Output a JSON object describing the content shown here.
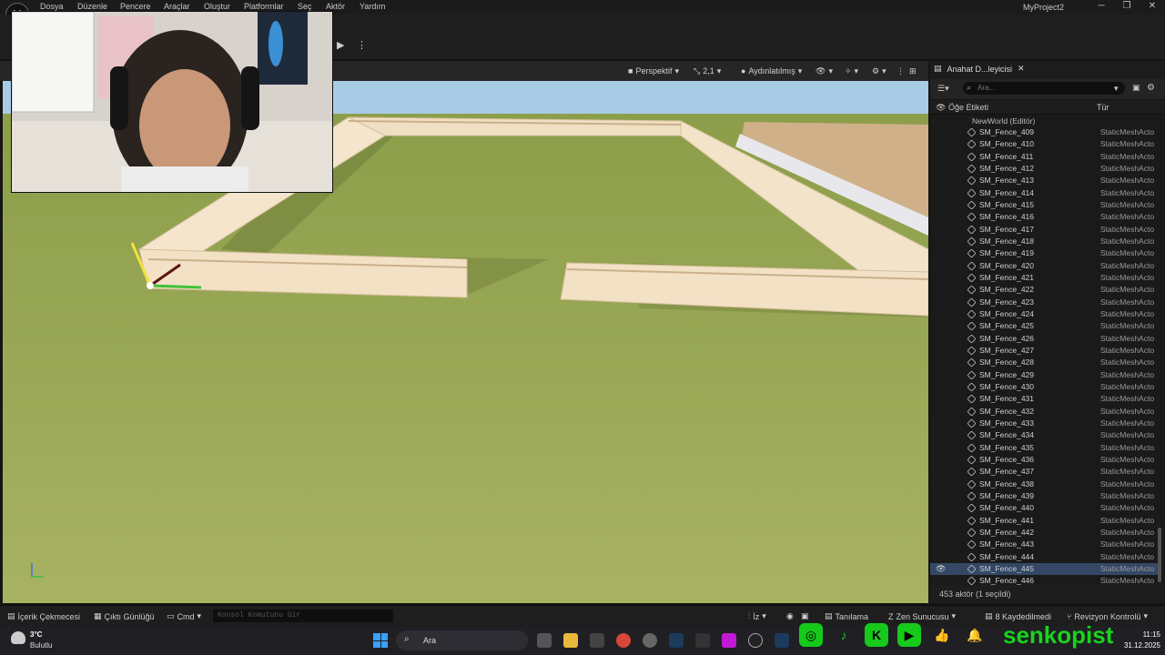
{
  "menu": [
    "Dosya",
    "Düzenle",
    "Pencere",
    "Araçlar",
    "Oluştur",
    "Platformlar",
    "Seç",
    "Aktör",
    "Yardım"
  ],
  "project_title": "MyProject2",
  "viewport": {
    "perspective": "Perspektif",
    "scale": "2,1",
    "lighting": "Aydınlatılmış"
  },
  "outliner": {
    "tab_title": "Anahat D...leyicisi",
    "search_placeholder": "Ara...",
    "col_label": "Öğe Etiketi",
    "col_type": "Tür",
    "world": "NewWorld (Editör)",
    "rows": [
      {
        "name": "SM_Fence_409",
        "type": "StaticMeshActo"
      },
      {
        "name": "SM_Fence_410",
        "type": "StaticMeshActo"
      },
      {
        "name": "SM_Fence_411",
        "type": "StaticMeshActo"
      },
      {
        "name": "SM_Fence_412",
        "type": "StaticMeshActo"
      },
      {
        "name": "SM_Fence_413",
        "type": "StaticMeshActo"
      },
      {
        "name": "SM_Fence_414",
        "type": "StaticMeshActo"
      },
      {
        "name": "SM_Fence_415",
        "type": "StaticMeshActo"
      },
      {
        "name": "SM_Fence_416",
        "type": "StaticMeshActo"
      },
      {
        "name": "SM_Fence_417",
        "type": "StaticMeshActo"
      },
      {
        "name": "SM_Fence_418",
        "type": "StaticMeshActo"
      },
      {
        "name": "SM_Fence_419",
        "type": "StaticMeshActo"
      },
      {
        "name": "SM_Fence_420",
        "type": "StaticMeshActo"
      },
      {
        "name": "SM_Fence_421",
        "type": "StaticMeshActo"
      },
      {
        "name": "SM_Fence_422",
        "type": "StaticMeshActo"
      },
      {
        "name": "SM_Fence_423",
        "type": "StaticMeshActo"
      },
      {
        "name": "SM_Fence_424",
        "type": "StaticMeshActo"
      },
      {
        "name": "SM_Fence_425",
        "type": "StaticMeshActo"
      },
      {
        "name": "SM_Fence_426",
        "type": "StaticMeshActo"
      },
      {
        "name": "SM_Fence_427",
        "type": "StaticMeshActo"
      },
      {
        "name": "SM_Fence_428",
        "type": "StaticMeshActo"
      },
      {
        "name": "SM_Fence_429",
        "type": "StaticMeshActo"
      },
      {
        "name": "SM_Fence_430",
        "type": "StaticMeshActo"
      },
      {
        "name": "SM_Fence_431",
        "type": "StaticMeshActo"
      },
      {
        "name": "SM_Fence_432",
        "type": "StaticMeshActo"
      },
      {
        "name": "SM_Fence_433",
        "type": "StaticMeshActo"
      },
      {
        "name": "SM_Fence_434",
        "type": "StaticMeshActo"
      },
      {
        "name": "SM_Fence_435",
        "type": "StaticMeshActo"
      },
      {
        "name": "SM_Fence_436",
        "type": "StaticMeshActo"
      },
      {
        "name": "SM_Fence_437",
        "type": "StaticMeshActo"
      },
      {
        "name": "SM_Fence_438",
        "type": "StaticMeshActo"
      },
      {
        "name": "SM_Fence_439",
        "type": "StaticMeshActo"
      },
      {
        "name": "SM_Fence_440",
        "type": "StaticMeshActo"
      },
      {
        "name": "SM_Fence_441",
        "type": "StaticMeshActo"
      },
      {
        "name": "SM_Fence_442",
        "type": "StaticMeshActo"
      },
      {
        "name": "SM_Fence_443",
        "type": "StaticMeshActo"
      },
      {
        "name": "SM_Fence_444",
        "type": "StaticMeshActo"
      },
      {
        "name": "SM_Fence_445",
        "type": "StaticMeshActo",
        "selected": true
      },
      {
        "name": "SM_Fence_446",
        "type": "StaticMeshActo"
      }
    ],
    "actor_count": "453 aktör (1 seçildi)"
  },
  "statusbar": {
    "content_drawer": "İçerik Çekmecesi",
    "output_log": "Çıktı Günlüğü",
    "cmd": "Cmd",
    "console_placeholder": "Konsol Komutunu Gir",
    "trace": "İz",
    "derived_data": "Tanılama",
    "zen": "Zen Sunucusu",
    "unsaved": "8 Kaydedilmedi",
    "revision": "Revizyon Kontrolü"
  },
  "taskbar": {
    "temp": "3°C",
    "weather": "Bulutlu",
    "search": "Ara",
    "time": "11:15",
    "date": "31.12.2025"
  },
  "overlay": {
    "brand": "senkopist"
  },
  "colors": {
    "grass": "#9fae5c",
    "sky": "#a8cbe6",
    "fence": "#f1dfc3",
    "selection": "#344866",
    "brand_green": "#18d41c"
  }
}
